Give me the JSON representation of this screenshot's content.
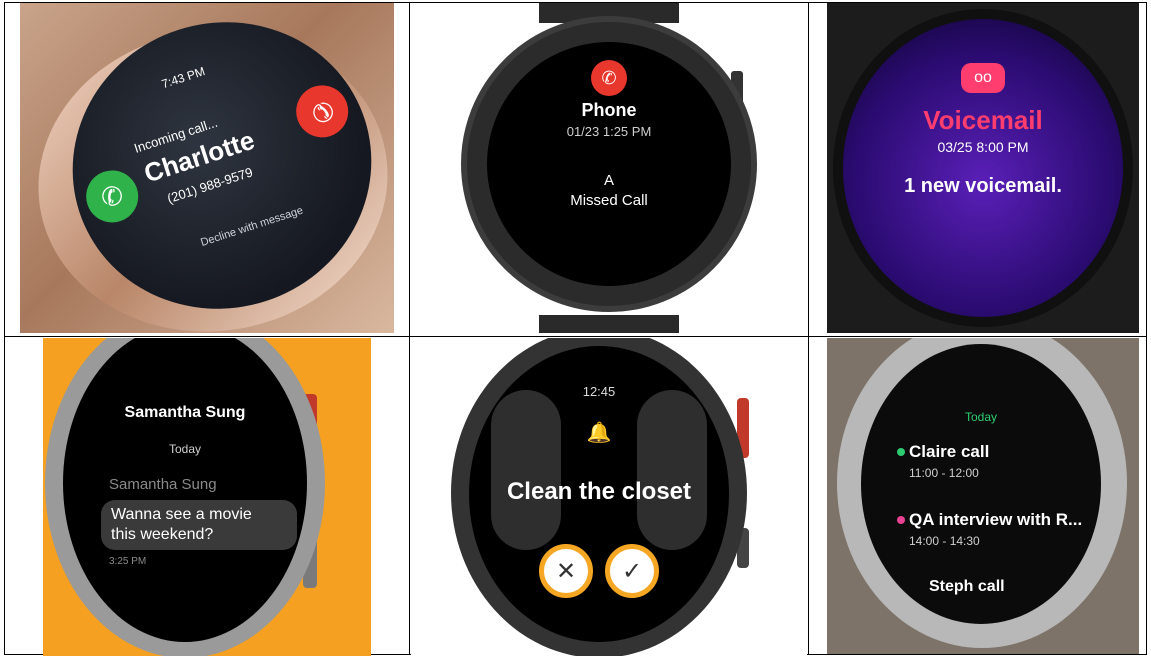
{
  "cells": {
    "incoming_call": {
      "time": "7:43 PM",
      "status": "Incoming call...",
      "caller": "Charlotte",
      "number": "(201) 988-9579",
      "decline_hint": "Decline with message"
    },
    "missed_call": {
      "app": "Phone",
      "datetime": "01/23 1:25 PM",
      "line1": "A",
      "line2": "Missed Call"
    },
    "voicemail": {
      "title": "Voicemail",
      "datetime": "03/25 8:00 PM",
      "message": "1 new voicemail."
    },
    "message": {
      "contact": "Samantha Sung",
      "day": "Today",
      "sender": "Samantha Sung",
      "text_line1": "Wanna see a movie",
      "text_line2": "this weekend?",
      "time": "3:25 PM"
    },
    "reminder": {
      "time": "12:45",
      "text": "Clean the closet"
    },
    "calendar": {
      "header": "Today",
      "events": [
        {
          "title": "Claire call",
          "time": "11:00 - 12:00",
          "color": "#2ecc71"
        },
        {
          "title": "QA interview with R...",
          "time": "14:00 - 14:30",
          "color": "#e84393"
        },
        {
          "title": "Steph call",
          "time": "",
          "color": "#2ecc71"
        }
      ]
    }
  },
  "colors": {
    "accept": "#2fb24a",
    "decline": "#e8372c",
    "voicemail_accent": "#ff3d6e",
    "reminder_accent": "#f5a623",
    "bell": "#5b6ef5"
  }
}
